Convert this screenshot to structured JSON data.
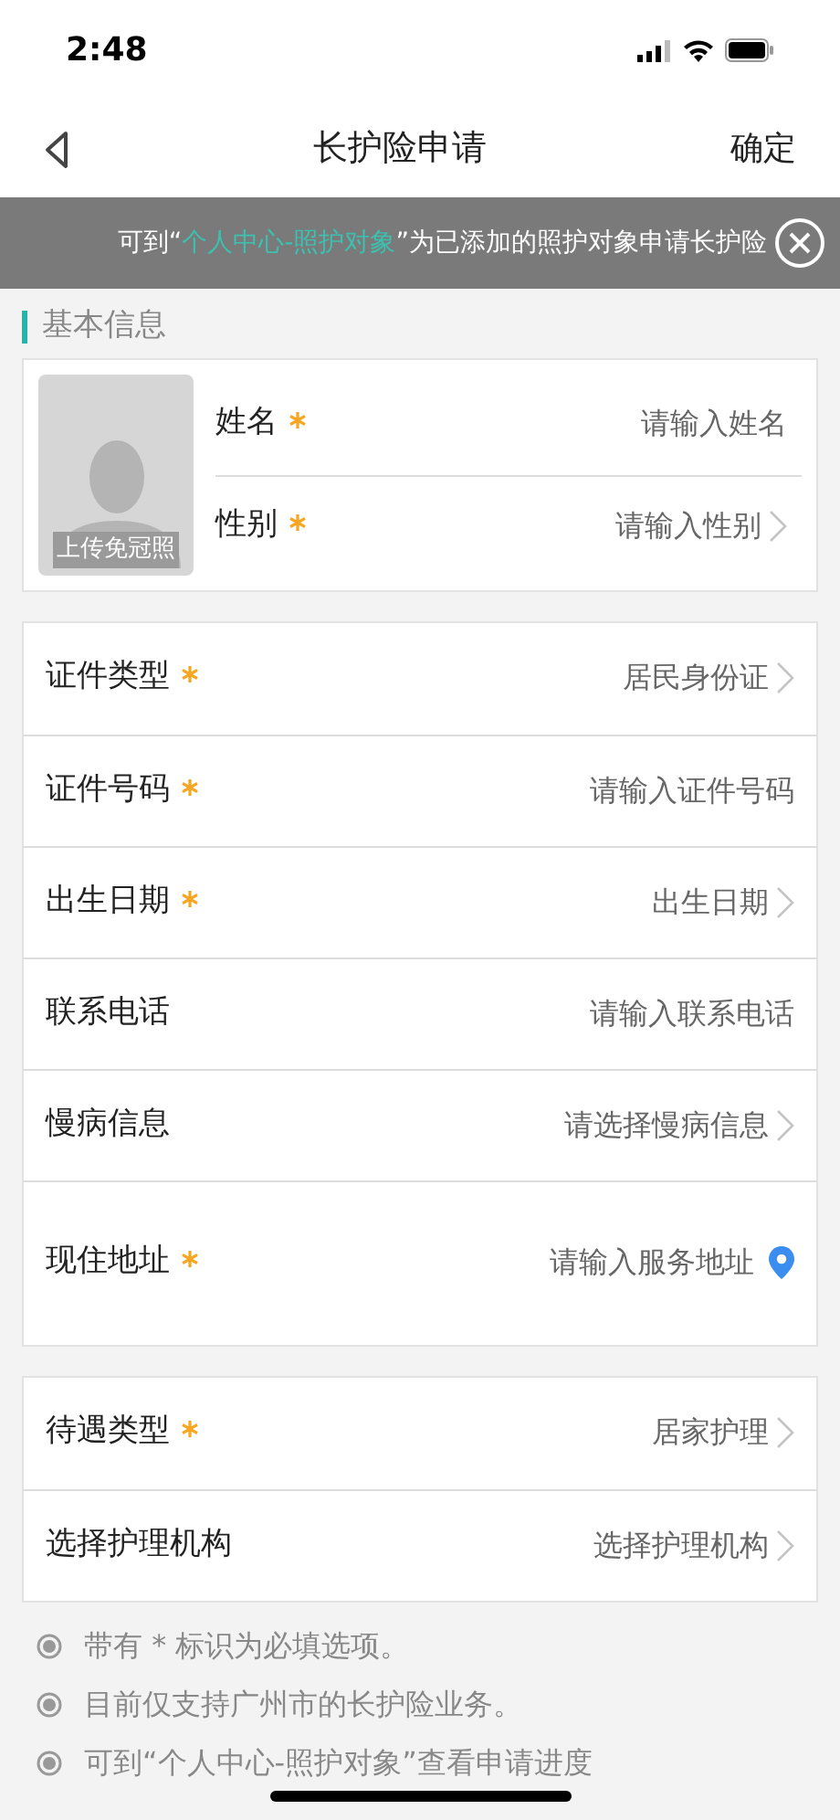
{
  "status_bar": {
    "time": "2:48"
  },
  "nav": {
    "title": "长护险申请",
    "action": "确定"
  },
  "banner": {
    "prefix": "可到“",
    "link": "个人中心-照护对象",
    "suffix": "”为已添加的照护对象申请长护险"
  },
  "section": {
    "title": "基本信息"
  },
  "photo": {
    "caption": "上传免冠照"
  },
  "basic_rows": [
    {
      "label": "姓名",
      "required": true,
      "value": "请输入姓名",
      "kind": "input"
    },
    {
      "label": "性别",
      "required": true,
      "value": "请输入性别",
      "kind": "select"
    }
  ],
  "groups": [
    [
      {
        "label": "证件类型",
        "required": true,
        "value": "居民身份证",
        "kind": "select"
      },
      {
        "label": "证件号码",
        "required": true,
        "value": "请输入证件号码",
        "kind": "input"
      },
      {
        "label": "出生日期",
        "required": true,
        "value": "出生日期",
        "kind": "select"
      },
      {
        "label": "联系电话",
        "required": false,
        "value": "请输入联系电话",
        "kind": "input"
      },
      {
        "label": "慢病信息",
        "required": false,
        "value": "请选择慢病信息",
        "kind": "select"
      },
      {
        "label": "现住地址",
        "required": true,
        "value": "请输入服务地址",
        "kind": "location"
      }
    ],
    [
      {
        "label": "待遇类型",
        "required": true,
        "value": "居家护理",
        "kind": "select"
      },
      {
        "label": "选择护理机构",
        "required": false,
        "value": "选择护理机构",
        "kind": "select"
      }
    ]
  ],
  "notes": [
    "带有 * 标识为必填选项。",
    "目前仅支持广州市的长护险业务。",
    "可到“个人中心-照护对象”查看申请进度"
  ]
}
